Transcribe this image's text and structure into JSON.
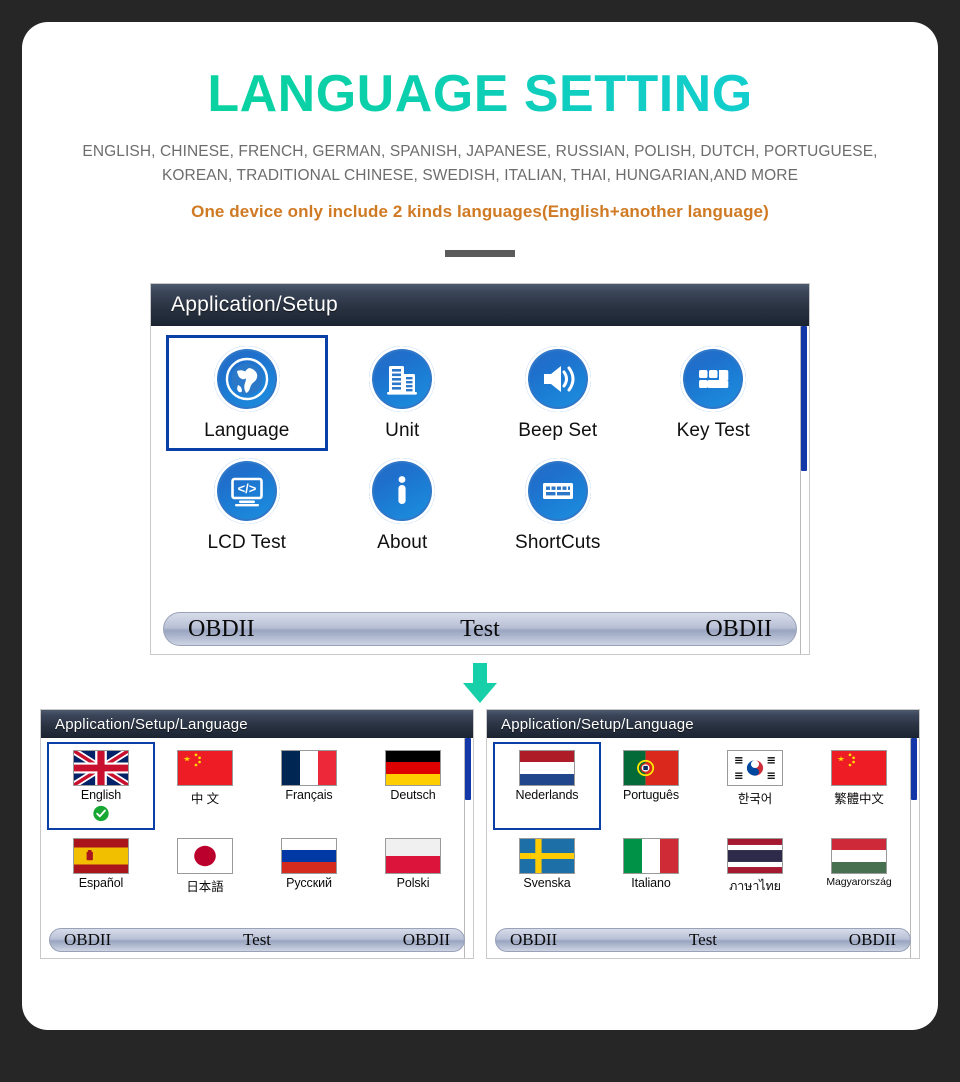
{
  "hero": {
    "title": "LANGUAGE SETTING",
    "languages_line1": "ENGLISH, CHINESE, FRENCH, GERMAN, SPANISH, JAPANESE, RUSSIAN, POLISH, DUTCH, PORTUGUESE,",
    "languages_line2": "KOREAN, TRADITIONAL CHINESE, SWEDISH, ITALIAN, THAI, HUNGARIAN,AND MORE",
    "note": "One device only include 2 kinds languages(English+another language)",
    "title_gradient_from": "#07d694",
    "title_gradient_to": "#15cfd9",
    "note_color": "#d07a24",
    "arrow_color": "#17cfa8"
  },
  "setup_screen": {
    "breadcrumb": "Application/Setup",
    "tiles": [
      {
        "label": "Language",
        "icon": "globe-icon",
        "selected": true
      },
      {
        "label": "Unit",
        "icon": "buildings-icon",
        "selected": false
      },
      {
        "label": "Beep Set",
        "icon": "speaker-icon",
        "selected": false
      },
      {
        "label": "Key Test",
        "icon": "keypad-icon",
        "selected": false
      },
      {
        "label": "LCD Test",
        "icon": "code-screen-icon",
        "selected": false
      },
      {
        "label": "About",
        "icon": "info-icon",
        "selected": false
      },
      {
        "label": "ShortCuts",
        "icon": "keyboard-icon",
        "selected": false
      }
    ],
    "bottom_bar": {
      "left": "OBDII",
      "middle": "Test",
      "right": "OBDII"
    }
  },
  "language_screen_left": {
    "breadcrumb": "Application/Setup/Language",
    "tiles": [
      {
        "label": "English",
        "flag": "uk",
        "selected": true,
        "checked": true
      },
      {
        "label": "中 文",
        "flag": "china",
        "selected": false,
        "checked": false
      },
      {
        "label": "Français",
        "flag": "france",
        "selected": false,
        "checked": false
      },
      {
        "label": "Deutsch",
        "flag": "germany",
        "selected": false,
        "checked": false
      },
      {
        "label": "Español",
        "flag": "spain",
        "selected": false,
        "checked": false
      },
      {
        "label": "日本語",
        "flag": "japan",
        "selected": false,
        "checked": false
      },
      {
        "label": "Русский",
        "flag": "russia",
        "selected": false,
        "checked": false
      },
      {
        "label": "Polski",
        "flag": "poland",
        "selected": false,
        "checked": false
      }
    ],
    "bottom_bar": {
      "left": "OBDII",
      "middle": "Test",
      "right": "OBDII"
    }
  },
  "language_screen_right": {
    "breadcrumb": "Application/Setup/Language",
    "tiles": [
      {
        "label": "Nederlands",
        "flag": "netherlands",
        "selected": true,
        "checked": false
      },
      {
        "label": "Português",
        "flag": "portugal",
        "selected": false,
        "checked": false
      },
      {
        "label": "한국어",
        "flag": "korea",
        "selected": false,
        "checked": false
      },
      {
        "label": "繁體中文",
        "flag": "china",
        "selected": false,
        "checked": false
      },
      {
        "label": "Svenska",
        "flag": "sweden",
        "selected": false,
        "checked": false
      },
      {
        "label": "Italiano",
        "flag": "italy",
        "selected": false,
        "checked": false
      },
      {
        "label": "ภาษาไทย",
        "flag": "thailand",
        "selected": false,
        "checked": false
      },
      {
        "label": "Magyarország",
        "flag": "hungary",
        "selected": false,
        "checked": false
      }
    ],
    "bottom_bar": {
      "left": "OBDII",
      "middle": "Test",
      "right": "OBDII"
    }
  }
}
